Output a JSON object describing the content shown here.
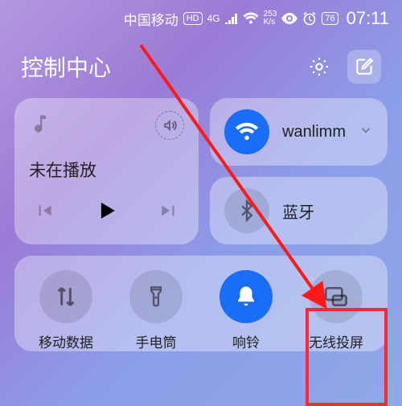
{
  "status": {
    "carrier": "中国移动",
    "hd": "HD",
    "net_gen": "4G",
    "speed_top": "253",
    "speed_bot": "K/s",
    "battery": "76",
    "time": "07:11"
  },
  "header": {
    "title": "控制中心"
  },
  "music": {
    "status": "未在播放"
  },
  "wifi": {
    "ssid": "wanlimm",
    "active": true
  },
  "bluetooth": {
    "label": "蓝牙",
    "active": false
  },
  "toggles": [
    {
      "key": "mobile-data",
      "label": "移动数据",
      "active": false
    },
    {
      "key": "flashlight",
      "label": "手电筒",
      "active": false
    },
    {
      "key": "ringer",
      "label": "响铃",
      "active": true
    },
    {
      "key": "wireless-cast",
      "label": "无线投屏",
      "active": false
    }
  ],
  "annotation": {
    "highlight_toggle": "wireless-cast",
    "arrow_color": "#ff1a1a"
  }
}
